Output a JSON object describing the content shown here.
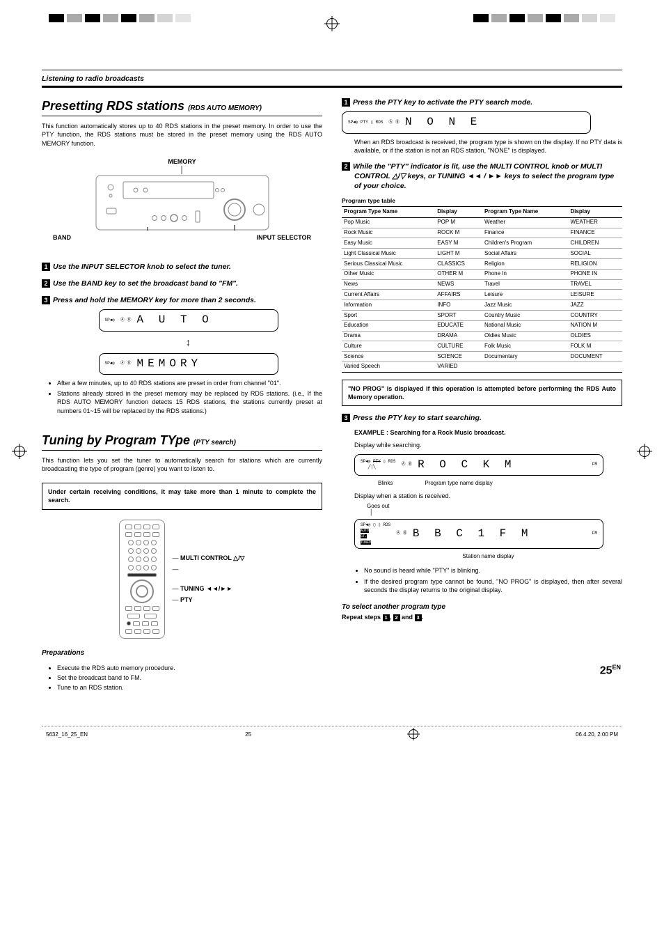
{
  "header_section": "Listening to radio broadcasts",
  "left": {
    "title1": "Presetting RDS stations",
    "title1_sub": "(RDS AUTO MEMORY)",
    "intro1": "This function automatically stores up to 40 RDS stations in the preset memory. In order to use the PTY function, the RDS stations must be stored in the preset memory using the RDS AUTO MEMORY function.",
    "diag_top_label": "MEMORY",
    "diag_left_label": "BAND",
    "diag_right_label": "INPUT SELECTOR",
    "step1": "Use the INPUT SELECTOR knob to select the tuner.",
    "step2": "Use the BAND key to set the broadcast band to \"FM\".",
    "step3": "Press and hold the MEMORY key for more than 2 seconds.",
    "lcd1": "A U T O",
    "lcd2": "MEMORY",
    "bullet1": "After a few minutes, up to 40 RDS stations are preset in order from channel \"01\".",
    "bullet2": "Stations already stored in the preset memory may be replaced by RDS stations. (i.e., If the RDS AUTO MEMORY function detects 15 RDS stations, the stations currently preset at numbers 01~15 will be replaced by the RDS stations.)",
    "title2": "Tuning by Program TYpe",
    "title2_sub": "(PTY search)",
    "intro2": "This function lets you set the tuner to automatically search for stations which are currently broadcasting the type of program (genre) you want to listen to.",
    "notebox": "Under certain receiving conditions, it may take more than 1 minute to complete the search.",
    "remote_lbl1": "MULTI CONTROL △/▽",
    "remote_lbl2": "TUNING ◄◄/►►",
    "remote_lbl3": "PTY",
    "preps_title": "Preparations",
    "prep1": "Execute the RDS auto memory procedure.",
    "prep2": "Set the broadcast band to FM.",
    "prep3": "Tune to an RDS station."
  },
  "right": {
    "step1": "Press the PTY key to activate the PTY search mode.",
    "lcd1": "N O N E",
    "after_lcd1": "When an RDS broadcast is received, the program type is shown on the display.  If no PTY data is available, or if the station is not an RDS station, \"NONE\" is displayed.",
    "step2": "While the \"PTY\" indicator is lit, use the MULTI CONTROL knob or MULTI CONTROL △/▽ keys, or TUNING  ◄◄ / ►► keys to select the program type of your choice.",
    "pty_table_title": "Program type table",
    "th1": "Program Type Name",
    "th2": "Display",
    "th3": "Program Type Name",
    "th4": "Display",
    "pty_rows": [
      [
        "Pop Music",
        "POP M",
        "Weather",
        "WEATHER"
      ],
      [
        "Rock Music",
        "ROCK M",
        "Finance",
        "FINANCE"
      ],
      [
        "Easy Music",
        "EASY M",
        "Children's Program",
        "CHILDREN"
      ],
      [
        "Light Classical Music",
        "LIGHT M",
        "Social Affairs",
        "SOCIAL"
      ],
      [
        "Serious Classical Music",
        "CLASSICS",
        "Religion",
        "RELIGION"
      ],
      [
        "Other Music",
        "OTHER M",
        "Phone In",
        "PHONE IN"
      ],
      [
        "News",
        "NEWS",
        "Travel",
        "TRAVEL"
      ],
      [
        "Current Affairs",
        "AFFAIRS",
        "Leisure",
        "LEISURE"
      ],
      [
        "Information",
        "INFO",
        "Jazz Music",
        "JAZZ"
      ],
      [
        "Sport",
        "SPORT",
        "Country Music",
        "COUNTRY"
      ],
      [
        "Education",
        "EDUCATE",
        "National Music",
        "NATION M"
      ],
      [
        "Drama",
        "DRAMA",
        "Oldies Music",
        "OLDIES"
      ],
      [
        "Culture",
        "CULTURE",
        "Folk Music",
        "FOLK M"
      ],
      [
        "Science",
        "SCIENCE",
        "Documentary",
        "DOCUMENT"
      ],
      [
        "Varied Speech",
        "VARIED",
        "",
        ""
      ]
    ],
    "noprog_box": "\"NO PROG\" is displayed if this operation is attempted before performing the RDS Auto Memory operation.",
    "step3": "Press the PTY key to start searching.",
    "ex_title": "EXAMPLE : Searching for a Rock Music broadcast.",
    "search_caption": "Display while searching.",
    "lcd_rock": "R O C K   M",
    "blinks_lbl": "Blinks",
    "ptyname_lbl": "Program type name display",
    "recv_caption": "Display when a station is received.",
    "goes_out": "Goes out",
    "lcd_bbc": "B B C     1   F M",
    "station_name_lbl": "Station name display",
    "end_bullet1": "No sound is heard while \"PTY\" is blinking.",
    "end_bullet2": "If the desired program type cannot be found, \"NO PROG\" is displayed, then after several seconds the display returns to the original display.",
    "select_another": "To select another program type",
    "repeat_a": "Repeat steps ",
    "repeat_b": ", ",
    "repeat_c": " and ",
    "repeat_d": "."
  },
  "page_number_num": "25",
  "page_number_suffix": "EN",
  "footer_left": "5632_16_25_EN",
  "footer_mid": "25",
  "footer_right": "06.4.20, 2:00 PM"
}
